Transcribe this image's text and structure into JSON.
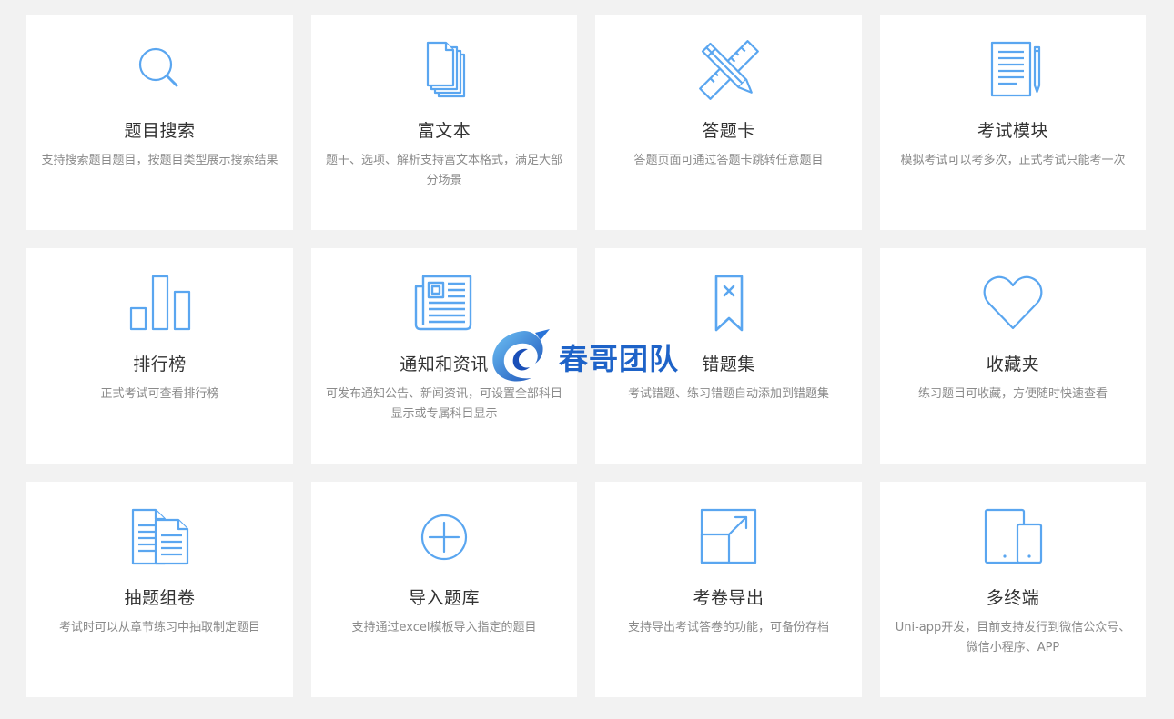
{
  "accent_color": "#5aa6f0",
  "cards": [
    {
      "icon": "search-icon",
      "title": "题目搜索",
      "desc": "支持搜索题目题目，按题目类型展示搜索结果"
    },
    {
      "icon": "documents-icon",
      "title": "富文本",
      "desc": "题干、选项、解析支持富文本格式，满足大部分场景"
    },
    {
      "icon": "ruler-pencil-icon",
      "title": "答题卡",
      "desc": "答题页面可通过答题卡跳转任意题目"
    },
    {
      "icon": "notepad-pencil-icon",
      "title": "考试模块",
      "desc": "模拟考试可以考多次，正式考试只能考一次"
    },
    {
      "icon": "bar-chart-icon",
      "title": "排行榜",
      "desc": "正式考试可查看排行榜"
    },
    {
      "icon": "newspaper-icon",
      "title": "通知和资讯",
      "desc": "可发布通知公告、新闻资讯，可设置全部科目显示或专属科目显示"
    },
    {
      "icon": "bookmark-x-icon",
      "title": "错题集",
      "desc": "考试错题、练习错题自动添加到错题集"
    },
    {
      "icon": "heart-icon",
      "title": "收藏夹",
      "desc": "练习题目可收藏，方便随时快速查看"
    },
    {
      "icon": "document-stack-icon",
      "title": "抽题组卷",
      "desc": "考试时可以从章节练习中抽取制定题目"
    },
    {
      "icon": "plus-circle-icon",
      "title": "导入题库",
      "desc": "支持通过excel模板导入指定的题目"
    },
    {
      "icon": "export-icon",
      "title": "考卷导出",
      "desc": "支持导出考试答卷的功能，可备份存档"
    },
    {
      "icon": "devices-icon",
      "title": "多终端",
      "desc": "Uni-app开发，目前支持发行到微信公众号、微信小程序、APP"
    }
  ],
  "watermark": {
    "text": "春哥团队",
    "icon": "logo-swirl-icon"
  }
}
